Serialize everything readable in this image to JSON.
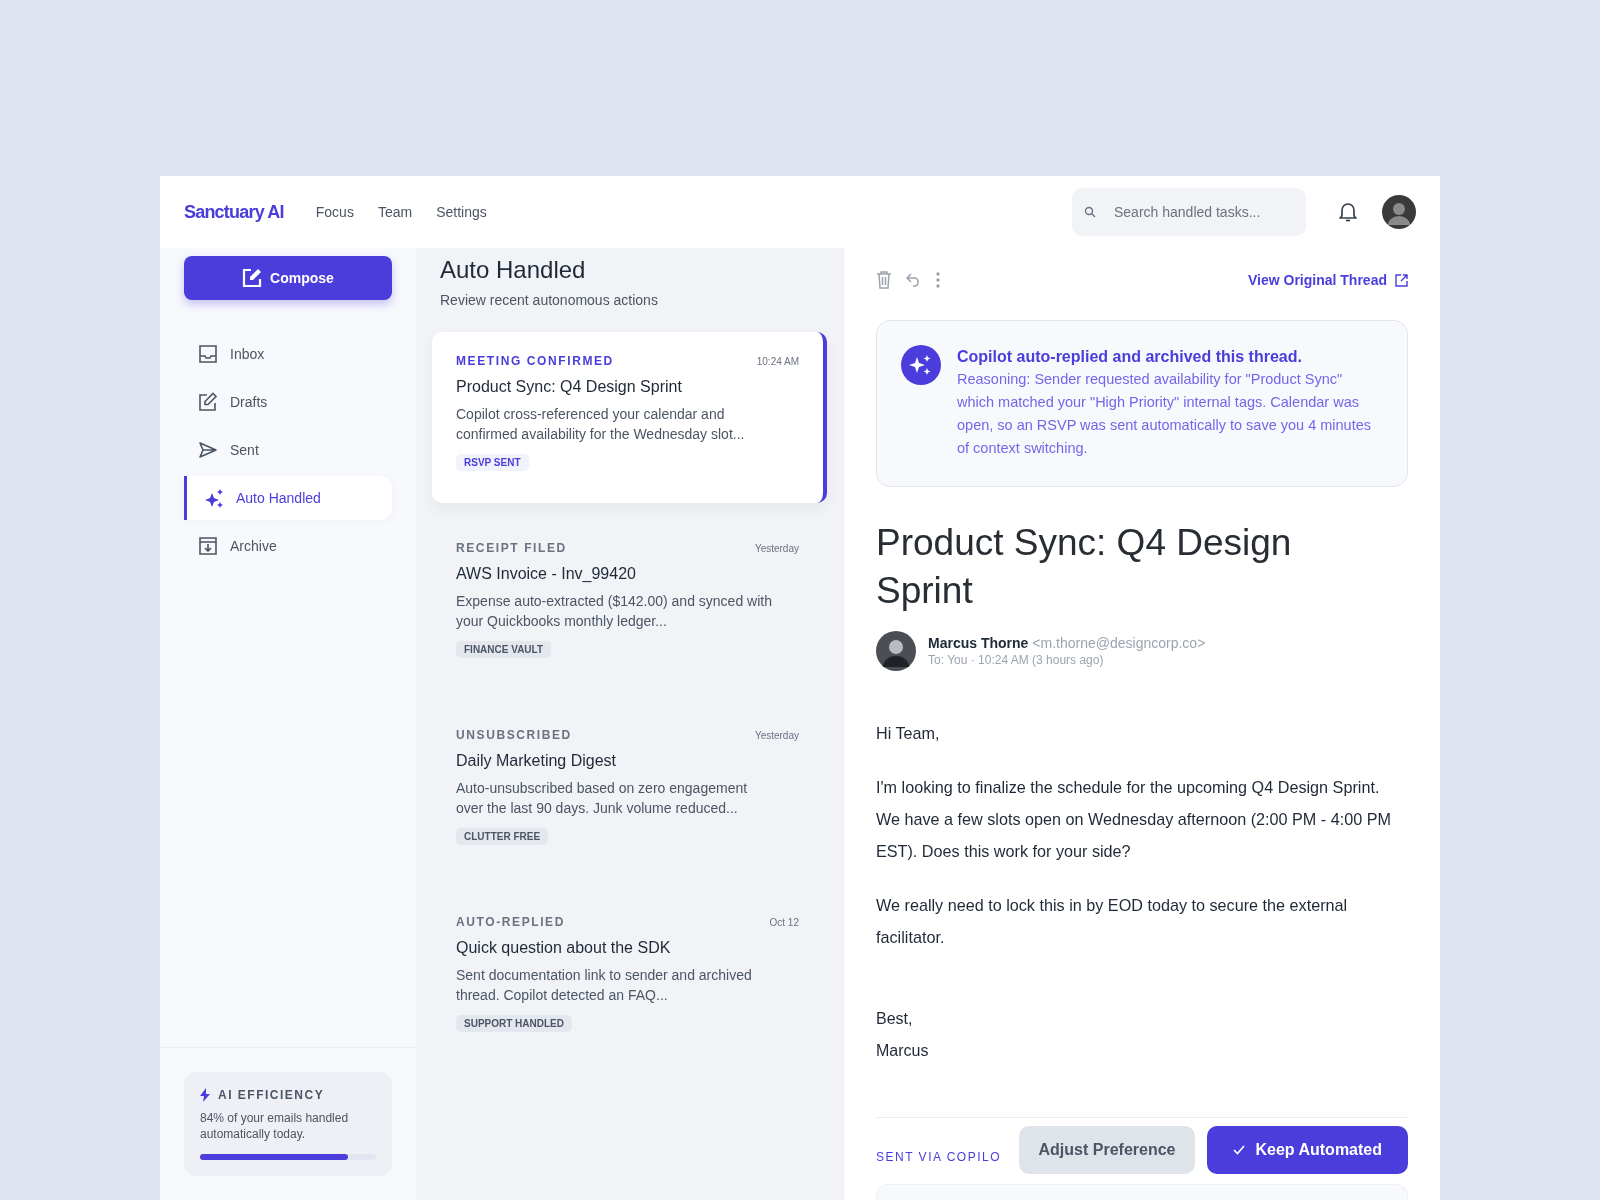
{
  "app": {
    "logo": "Sanctuary AI"
  },
  "top_nav": [
    {
      "label": "Focus"
    },
    {
      "label": "Team"
    },
    {
      "label": "Settings"
    }
  ],
  "search": {
    "placeholder": "Search handled tasks..."
  },
  "compose_button": "Compose",
  "sidebar": {
    "items": [
      {
        "label": "Inbox",
        "kind": "inbox",
        "selected": false
      },
      {
        "label": "Drafts",
        "kind": "drafts",
        "selected": false
      },
      {
        "label": "Sent",
        "kind": "sent",
        "selected": false
      },
      {
        "label": "Auto Handled",
        "kind": "sparkle",
        "selected": true
      },
      {
        "label": "Archive",
        "kind": "archive",
        "selected": false
      }
    ]
  },
  "efficiency": {
    "title": "AI EFFICIENCY",
    "text": "84% of your emails handled automatically today.",
    "level": 0.84
  },
  "list": {
    "title": "Auto Handled",
    "subtitle": "Review recent autonomous actions",
    "items": [
      {
        "category": "MEETING CONFIRMED",
        "time": "10:24 AM",
        "subject": "Product Sync: Q4 Design Sprint",
        "summary": "Copilot cross-referenced your calendar and confirmed availability for the Wednesday slot...",
        "tag": "RSVP SENT",
        "selected": true
      },
      {
        "category": "RECEIPT FILED",
        "time": "Yesterday",
        "subject": "AWS Invoice - Inv_99420",
        "summary": "Expense auto-extracted ($142.00) and synced with your Quickbooks monthly ledger...",
        "tag": "FINANCE VAULT",
        "selected": false
      },
      {
        "category": "UNSUBSCRIBED",
        "time": "Yesterday",
        "subject": "Daily Marketing Digest",
        "summary": "Auto-unsubscribed based on zero engagement over the last 90 days. Junk volume reduced...",
        "tag": "CLUTTER FREE",
        "selected": false
      },
      {
        "category": "AUTO-REPLIED",
        "time": "Oct 12",
        "subject": "Quick question about the SDK",
        "summary": "Sent documentation link to sender and archived thread. Copilot detected an FAQ...",
        "tag": "SUPPORT HANDLED",
        "selected": false
      }
    ]
  },
  "detail": {
    "link": "View Original Thread",
    "banner": {
      "title": "Copilot auto-replied and archived this thread.",
      "text": "Reasoning: Sender requested availability for \"Product Sync\" which matched your \"High Priority\" internal tags. Calendar was open, so an RSVP was sent automatically to save you 4 minutes of context switching."
    },
    "subject": "Product Sync: Q4 Design Sprint",
    "sender": {
      "name": "Marcus Thorne",
      "email": "<m.thorne@designcorp.co>",
      "meta": "To: You · 10:24 AM (3 hours ago)"
    },
    "body": [
      "Hi Team,",
      "I'm looking to finalize the schedule for the upcoming Q4 Design Sprint. We have a few slots open on Wednesday afternoon (2:00 PM - 4:00 PM EST). Does this work for your side?",
      "We really need to lock this in by EOD today to secure the external facilitator."
    ],
    "signature": [
      "Best,",
      "Marcus"
    ],
    "footer_label": "SENT VIA COPILO",
    "buttons": [
      {
        "label": "Adjust Preference",
        "kind": "secondary"
      },
      {
        "label": "Keep Automated",
        "kind": "primary"
      }
    ]
  }
}
